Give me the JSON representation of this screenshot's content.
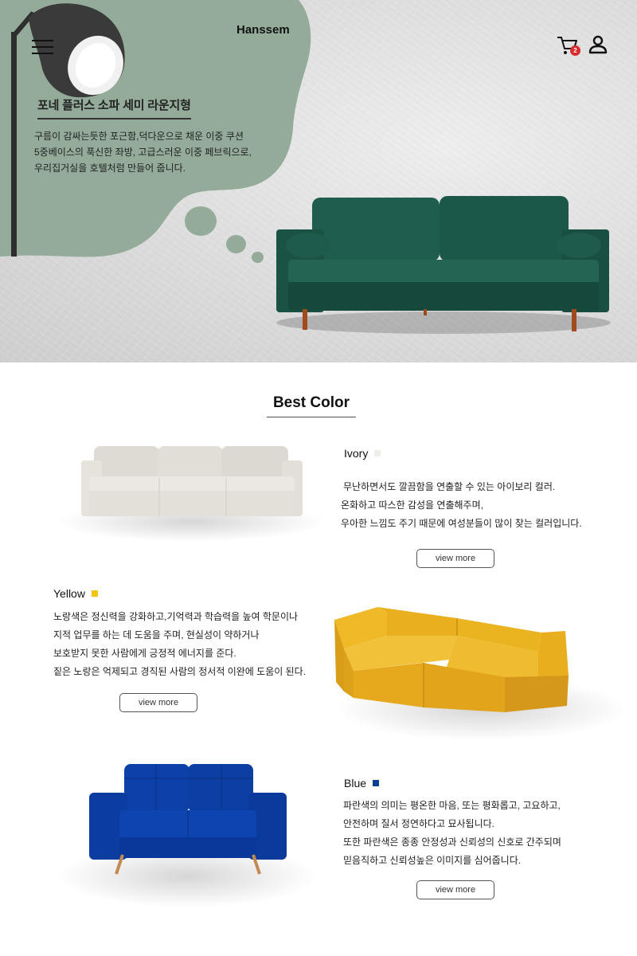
{
  "header": {
    "brand": "Hanssem",
    "cart_count": "2"
  },
  "hero": {
    "title": "포네 플러스 소파 세미 라운지형",
    "desc_lines": [
      "구름이 감싸는듯한 포근함,덕다운으로 채운 이중 쿠션",
      "5중베이스의 푹신한 좌방, 고급스러운 이중 페브릭으로,",
      "우리집거실을 호텔처럼 만들어 줍니다."
    ]
  },
  "section": {
    "title": "Best Color"
  },
  "colors": [
    {
      "name": "Ivory",
      "swatch": "#eeeeea",
      "lines": [
        "무난하면서도 깔끔함을 연출할 수 있는 아이보리 컬러.",
        "온화하고 따스한 감성을 연출해주며,",
        "우아한 느낌도 주기 때문에 여성분들이 많이 찾는 컬러입니다."
      ],
      "button": "view more"
    },
    {
      "name": "Yellow",
      "swatch": "#f3c416",
      "lines": [
        "노랑색은 정신력을 강화하고,기억력과 학습력을 높여 학문이나",
        "지적 업무를 하는 데 도움을 주며, 현실성이 약하거나",
        "보호받지 못한 사람에게 긍정적 에너지를 준다.",
        "짙은 노랑은 억제되고 경직된 사람의 정서적 이완에 도움이 된다."
      ],
      "button": "view more"
    },
    {
      "name": "Blue",
      "swatch": "#0d3f95",
      "lines": [
        "파란색의 의미는 평온한 마음, 또는 평화롭고, 고요하고,",
        "안전하며 질서 정연하다고 묘사됩니다.",
        "또한 파란색은 종종 안정성과 신뢰성의 신호로 간주되며",
        "믿음직하고 신뢰성높은 이미지를 심어줍니다."
      ],
      "button": "view more"
    }
  ],
  "palette": {
    "hero_blob": "#93ab98",
    "hero_sofa": "#1e5e4f",
    "ivory_sofa": "#e5e2dc",
    "yellow_sofa": "#eab421",
    "blue_sofa": "#0b3da6",
    "cart_badge": "#d82b2b"
  },
  "icons": [
    "hamburger-menu-icon",
    "cart-icon",
    "user-icon"
  ]
}
